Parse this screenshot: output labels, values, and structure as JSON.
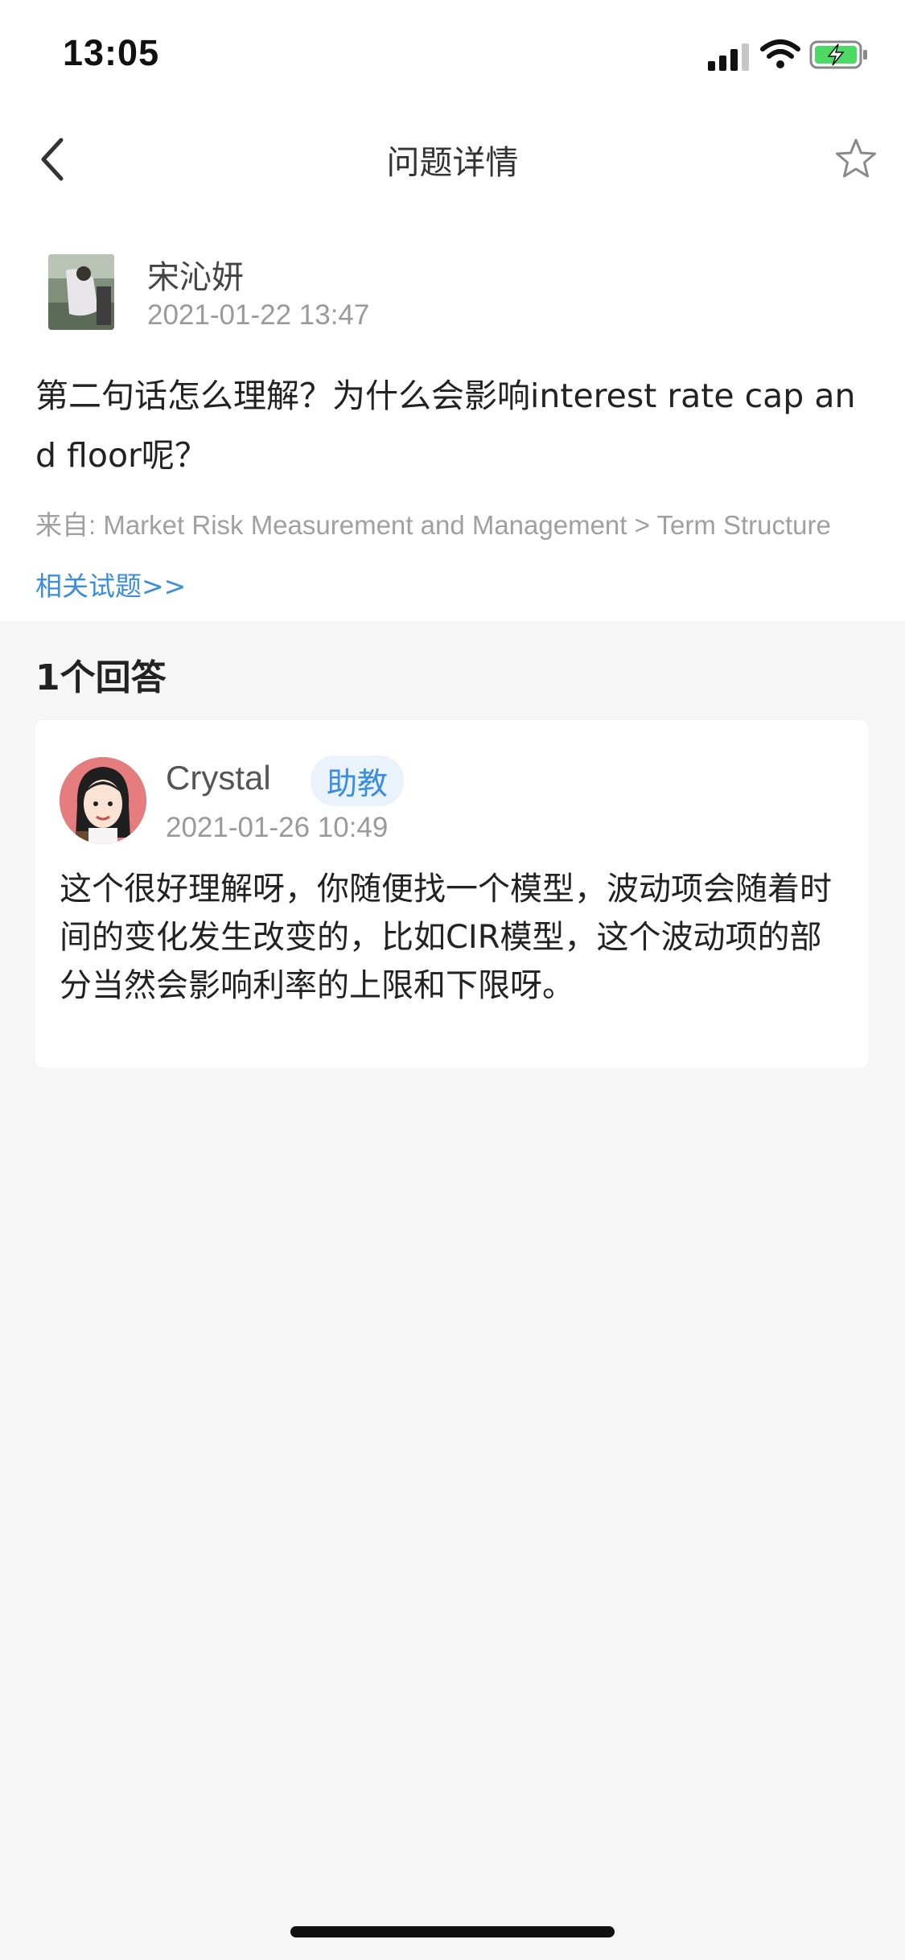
{
  "status_bar": {
    "time": "13:05"
  },
  "nav": {
    "title": "问题详情",
    "back_icon": "chevron-left-icon",
    "favorite_icon": "star-outline-icon"
  },
  "question": {
    "author": "宋沁妍",
    "time": "2021-01-22 13:47",
    "text": "第二句话怎么理解？为什么会影响interest rate cap and floor呢？",
    "source": "来自: Market Risk Measurement and Management > Term Structure",
    "related_link": "相关试题>>"
  },
  "answers": {
    "count_label": "1个回答",
    "items": [
      {
        "author": "Crystal",
        "badge": "助教",
        "time": "2021-01-26 10:49",
        "text": "这个很好理解呀，你随便找一个模型，波动项会随着时间的变化发生改变的，比如CIR模型，这个波动项的部分当然会影响利率的上限和下限呀。"
      }
    ]
  },
  "colors": {
    "accent": "#3b8de0",
    "background": "#f6f6f6",
    "battery_green": "#4cd964"
  }
}
